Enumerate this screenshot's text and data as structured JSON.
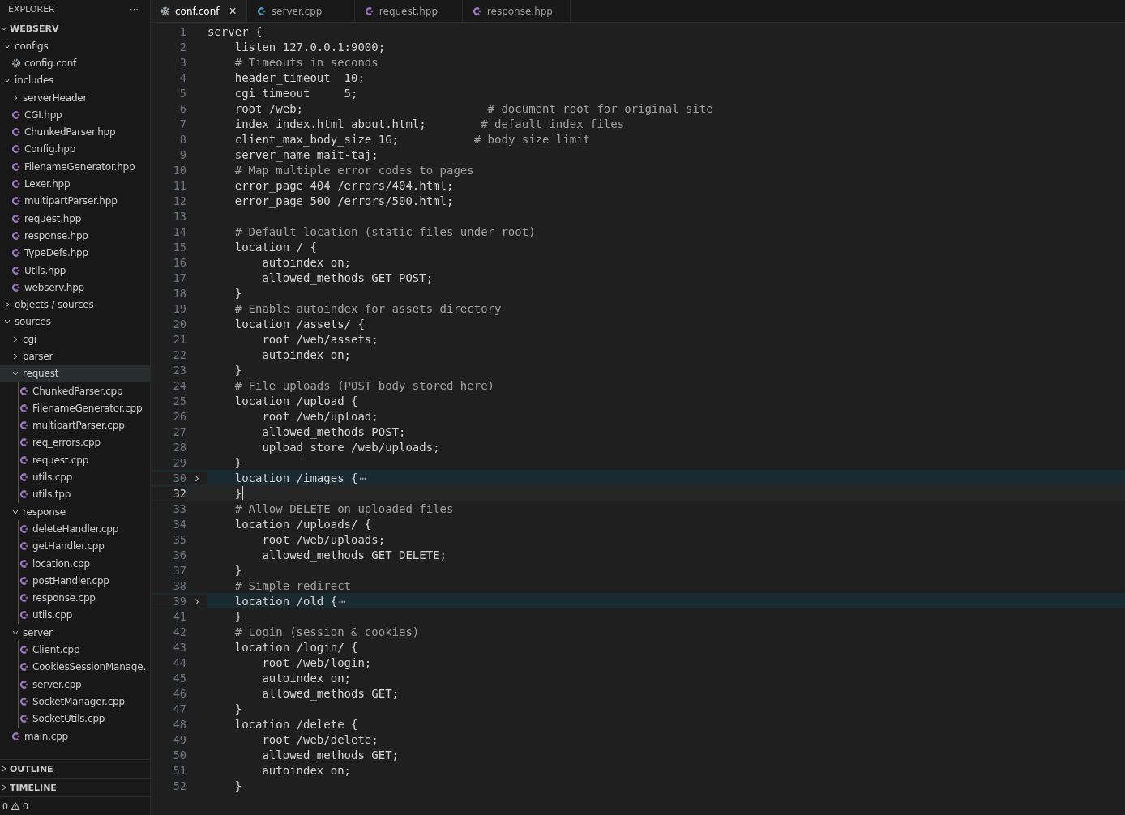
{
  "explorer": {
    "title": "EXPLORER",
    "more": "···",
    "root": {
      "label": "WEBSERV",
      "expanded": true,
      "children": [
        {
          "label": "configs",
          "kind": "folder",
          "expanded": true,
          "selected": false,
          "children": [
            {
              "label": "config.conf",
              "kind": "config",
              "selected": false
            }
          ]
        },
        {
          "label": "includes",
          "kind": "folder",
          "expanded": true,
          "selected": false,
          "children": [
            {
              "label": "serverHeader",
              "kind": "folder",
              "expanded": false,
              "selected": false
            },
            {
              "label": "CGI.hpp",
              "kind": "cpp",
              "selected": false
            },
            {
              "label": "ChunkedParser.hpp",
              "kind": "cpp",
              "selected": false
            },
            {
              "label": "Config.hpp",
              "kind": "cpp",
              "selected": false
            },
            {
              "label": "FilenameGenerator.hpp",
              "kind": "cpp",
              "selected": false
            },
            {
              "label": "Lexer.hpp",
              "kind": "cpp",
              "selected": false
            },
            {
              "label": "multipartParser.hpp",
              "kind": "cpp",
              "selected": false
            },
            {
              "label": "request.hpp",
              "kind": "cpp",
              "selected": false
            },
            {
              "label": "response.hpp",
              "kind": "cpp",
              "selected": false
            },
            {
              "label": "TypeDefs.hpp",
              "kind": "cpp",
              "selected": false
            },
            {
              "label": "Utils.hpp",
              "kind": "cpp",
              "selected": false
            },
            {
              "label": "webserv.hpp",
              "kind": "cpp",
              "selected": false
            }
          ]
        },
        {
          "label": "objects / sources",
          "kind": "folder",
          "expanded": false,
          "selected": false
        },
        {
          "label": "sources",
          "kind": "folder",
          "expanded": true,
          "selected": false,
          "children": [
            {
              "label": "cgi",
              "kind": "folder",
              "expanded": false,
              "selected": false
            },
            {
              "label": "parser",
              "kind": "folder",
              "expanded": false,
              "selected": false
            },
            {
              "label": "request",
              "kind": "folder",
              "expanded": true,
              "selected": true,
              "children": [
                {
                  "label": "ChunkedParser.cpp",
                  "kind": "cpp",
                  "selected": false
                },
                {
                  "label": "FilenameGenerator.cpp",
                  "kind": "cpp",
                  "selected": false
                },
                {
                  "label": "multipartParser.cpp",
                  "kind": "cpp",
                  "selected": false
                },
                {
                  "label": "req_errors.cpp",
                  "kind": "cpp",
                  "selected": false
                },
                {
                  "label": "request.cpp",
                  "kind": "cpp",
                  "selected": false
                },
                {
                  "label": "utils.cpp",
                  "kind": "cpp",
                  "selected": false
                },
                {
                  "label": "utils.tpp",
                  "kind": "cpp",
                  "selected": false
                }
              ]
            },
            {
              "label": "response",
              "kind": "folder",
              "expanded": true,
              "selected": false,
              "children": [
                {
                  "label": "deleteHandler.cpp",
                  "kind": "cpp",
                  "selected": false
                },
                {
                  "label": "getHandler.cpp",
                  "kind": "cpp",
                  "selected": false
                },
                {
                  "label": "location.cpp",
                  "kind": "cpp",
                  "selected": false
                },
                {
                  "label": "postHandler.cpp",
                  "kind": "cpp",
                  "selected": false
                },
                {
                  "label": "response.cpp",
                  "kind": "cpp",
                  "selected": false
                },
                {
                  "label": "utils.cpp",
                  "kind": "cpp",
                  "selected": false
                }
              ]
            },
            {
              "label": "server",
              "kind": "folder",
              "expanded": true,
              "selected": false,
              "children": [
                {
                  "label": "Client.cpp",
                  "kind": "cpp",
                  "selected": false
                },
                {
                  "label": "CookiesSessionManage…",
                  "kind": "cpp",
                  "selected": false
                },
                {
                  "label": "server.cpp",
                  "kind": "cpp",
                  "selected": false
                },
                {
                  "label": "SocketManager.cpp",
                  "kind": "cpp",
                  "selected": false
                },
                {
                  "label": "SocketUtils.cpp",
                  "kind": "cpp",
                  "selected": false
                }
              ]
            },
            {
              "label": "main.cpp",
              "kind": "cpp",
              "selected": false
            }
          ]
        }
      ]
    }
  },
  "panels": [
    {
      "label": "OUTLINE",
      "expanded": false
    },
    {
      "label": "TIMELINE",
      "expanded": false
    }
  ],
  "status_bar": {
    "errors": "0",
    "warnings": "0"
  },
  "tabs": [
    {
      "label": "conf.conf",
      "kind": "config",
      "selected": true,
      "close": "×"
    },
    {
      "label": "server.cpp",
      "kind": "cpp",
      "selected": false
    },
    {
      "label": "request.hpp",
      "kind": "cpp",
      "selected": false
    },
    {
      "label": "response.hpp",
      "kind": "cpp",
      "selected": false
    }
  ],
  "editor": {
    "lines": [
      {
        "number": "1",
        "code": "server {"
      },
      {
        "number": "2",
        "code": "    listen 127.0.0.1:9000;"
      },
      {
        "number": "3",
        "comment": "    # Timeouts in seconds"
      },
      {
        "number": "4",
        "code": "    header_timeout  10;"
      },
      {
        "number": "5",
        "code": "    cgi_timeout     5;"
      },
      {
        "number": "6",
        "code": "    root /web;                           ",
        "comment": "# document root for original site"
      },
      {
        "number": "7",
        "code": "    index index.html about.html;        ",
        "comment": "# default index files"
      },
      {
        "number": "8",
        "code": "    client_max_body_size 1G;           ",
        "comment": "# body size limit"
      },
      {
        "number": "9",
        "code": "    server_name mait-taj;"
      },
      {
        "number": "10",
        "comment": "    # Map multiple error codes to pages"
      },
      {
        "number": "11",
        "code": "    error_page 404 /errors/404.html;"
      },
      {
        "number": "12",
        "code": "    error_page 500 /errors/500.html;"
      },
      {
        "number": "13"
      },
      {
        "number": "14",
        "comment": "    # Default location (static files under root)"
      },
      {
        "number": "15",
        "code": "    location / {"
      },
      {
        "number": "16",
        "code": "        autoindex on;"
      },
      {
        "number": "17",
        "code": "        allowed_methods GET POST;"
      },
      {
        "number": "18",
        "code": "    }"
      },
      {
        "number": "19",
        "comment": "    # Enable autoindex for assets directory"
      },
      {
        "number": "20",
        "code": "    location /assets/ {"
      },
      {
        "number": "21",
        "code": "        root /web/assets;"
      },
      {
        "number": "22",
        "code": "        autoindex on;"
      },
      {
        "number": "23",
        "code": "    }"
      },
      {
        "number": "24",
        "comment": "    # File uploads (POST body stored here)"
      },
      {
        "number": "25",
        "code": "    location /upload {"
      },
      {
        "number": "26",
        "code": "        root /web/upload;"
      },
      {
        "number": "27",
        "code": "        allowed_methods POST;"
      },
      {
        "number": "28",
        "code": "        upload_store /web/uploads;"
      },
      {
        "number": "29",
        "code": "    }"
      },
      {
        "number": "30",
        "code": "    location /images {",
        "folded": true,
        "fold_mark": "⋯",
        "fold_toggle": "›"
      },
      {
        "number": "32",
        "code": "    }",
        "current": true
      },
      {
        "number": "33",
        "comment": "    # Allow DELETE on uploaded files"
      },
      {
        "number": "34",
        "code": "    location /uploads/ {"
      },
      {
        "number": "35",
        "code": "        root /web/uploads;"
      },
      {
        "number": "36",
        "code": "        allowed_methods GET DELETE;"
      },
      {
        "number": "37",
        "code": "    }"
      },
      {
        "number": "38",
        "comment": "    # Simple redirect"
      },
      {
        "number": "39",
        "code": "    location /old {",
        "folded": true,
        "fold_mark": "⋯",
        "fold_toggle": "›"
      },
      {
        "number": "41",
        "code": "    }"
      },
      {
        "number": "42",
        "comment": "    # Login (session & cookies)"
      },
      {
        "number": "43",
        "code": "    location /login/ {"
      },
      {
        "number": "44",
        "code": "        root /web/login;"
      },
      {
        "number": "45",
        "code": "        autoindex on;"
      },
      {
        "number": "46",
        "code": "        allowed_methods GET;"
      },
      {
        "number": "47",
        "code": "    }"
      },
      {
        "number": "48",
        "code": "    location /delete {"
      },
      {
        "number": "49",
        "code": "        root /web/delete;"
      },
      {
        "number": "50",
        "code": "        allowed_methods GET;"
      },
      {
        "number": "51",
        "code": "        autoindex on;"
      },
      {
        "number": "52",
        "code": "    }"
      }
    ]
  }
}
